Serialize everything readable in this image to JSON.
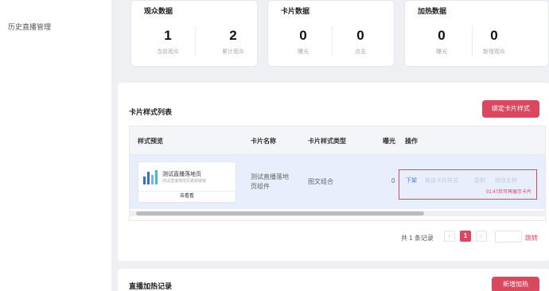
{
  "sidebar": {
    "item": "历史直播管理"
  },
  "stats": {
    "audience": {
      "title": "观众数据",
      "cols": [
        {
          "value": "1",
          "label": "当前观众"
        },
        {
          "value": "2",
          "label": "累计观众"
        }
      ]
    },
    "card": {
      "title": "卡片数据",
      "cols": [
        {
          "value": "0",
          "label": "曝光"
        },
        {
          "value": "0",
          "label": "点击"
        }
      ]
    },
    "boost": {
      "title": "加热数据",
      "cols": [
        {
          "value": "0",
          "label": "曝光"
        },
        {
          "value": "0",
          "label": "新增观众"
        }
      ]
    }
  },
  "card_list": {
    "title": "卡片样式列表",
    "bind_button": "绑定卡片样式",
    "headers": [
      "样式预览",
      "卡片名称",
      "卡片样式类型",
      "曝光",
      "操作"
    ],
    "row": {
      "preview_title": "测试直播落地页",
      "preview_sub": "测试直播落地页跳转链接",
      "preview_button": "去看看",
      "name_line1": "测试直播落地",
      "name_line2": "页组件",
      "type": "图文组合",
      "exposure": "0",
      "ops": [
        "下架",
        "推送卡片样式",
        "复制",
        "修改名称"
      ],
      "timer": "01:47后可再展示卡片"
    }
  },
  "pagination": {
    "total": "共 1 条记录",
    "prev": "‹",
    "current": "1",
    "next": "›",
    "jump": "跳转"
  },
  "boost_records": {
    "title": "直播加热记录",
    "add_button": "新增加热"
  },
  "colors": {
    "accent": "#d9485f",
    "row_highlight": "#e8eefc",
    "link": "#3d7bf0"
  }
}
